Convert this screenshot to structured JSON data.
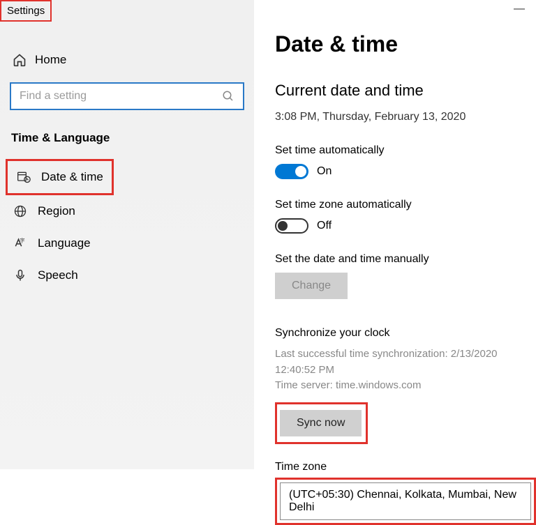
{
  "app": {
    "title": "Settings"
  },
  "sidebar": {
    "home_label": "Home",
    "search_placeholder": "Find a setting",
    "section": "Time & Language",
    "items": [
      {
        "label": "Date & time"
      },
      {
        "label": "Region"
      },
      {
        "label": "Language"
      },
      {
        "label": "Speech"
      }
    ]
  },
  "main": {
    "heading": "Date & time",
    "subheading": "Current date and time",
    "current_time": "3:08 PM, Thursday, February 13, 2020",
    "auto_time": {
      "label": "Set time automatically",
      "state": "On"
    },
    "auto_tz": {
      "label": "Set time zone automatically",
      "state": "Off"
    },
    "manual": {
      "label": "Set the date and time manually",
      "button": "Change"
    },
    "sync": {
      "heading": "Synchronize your clock",
      "last_line": "Last successful time synchronization: 2/13/2020 12:40:52 PM",
      "server_line": "Time server: time.windows.com",
      "button": "Sync now"
    },
    "timezone": {
      "label": "Time zone",
      "value": "(UTC+05:30) Chennai, Kolkata, Mumbai, New Delhi"
    }
  }
}
